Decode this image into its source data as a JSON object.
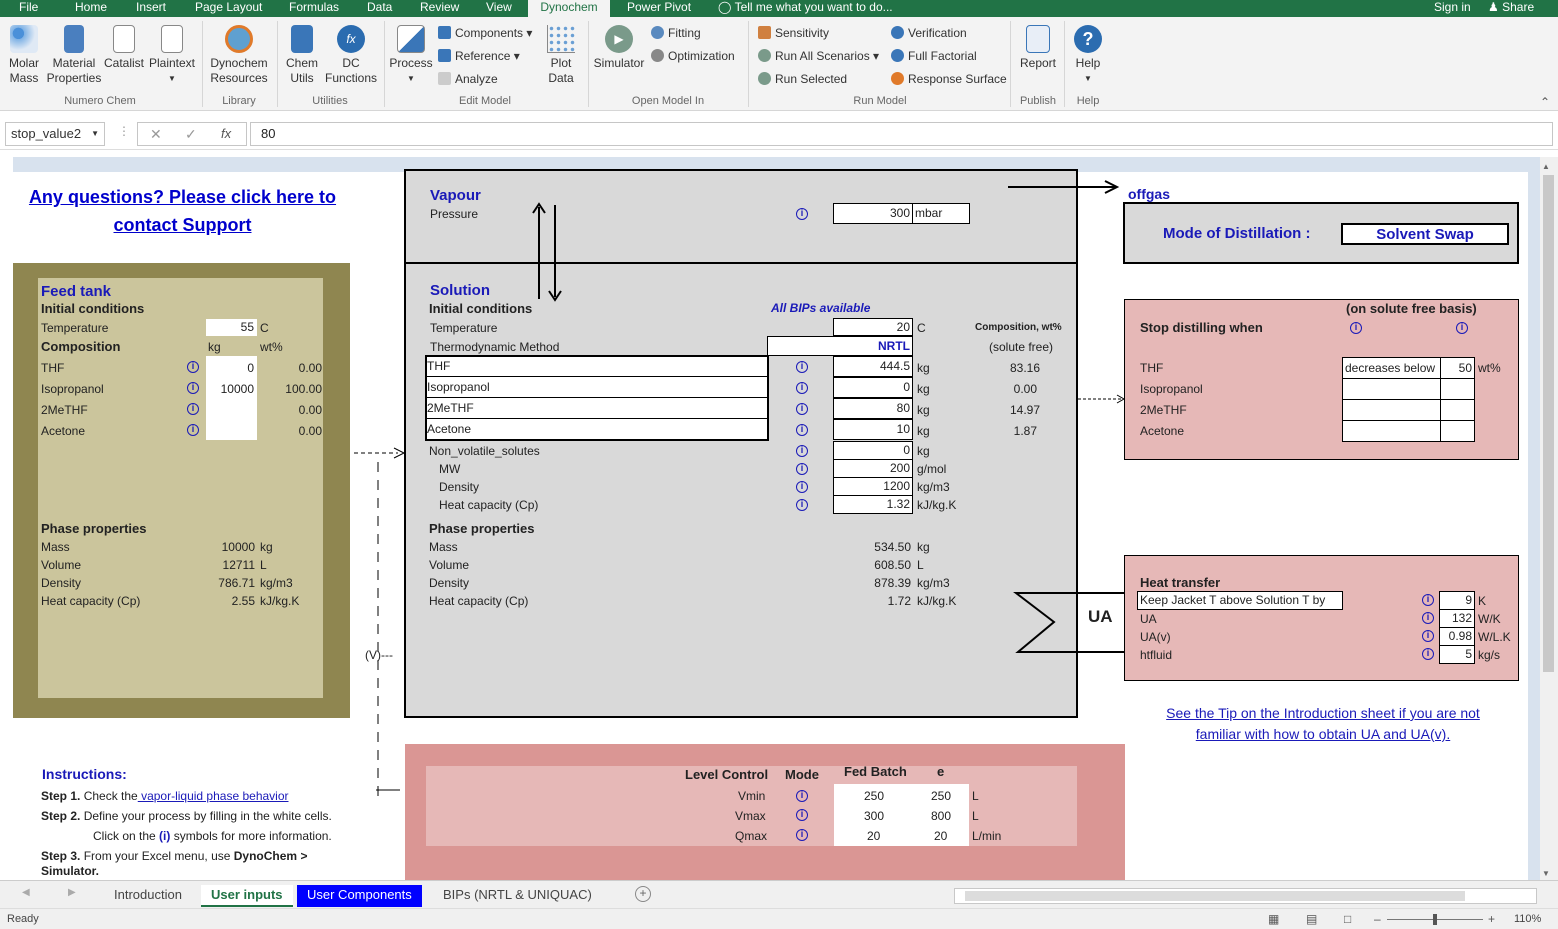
{
  "ribbon_tabs": [
    "File",
    "Home",
    "Insert",
    "Page Layout",
    "Formulas",
    "Data",
    "Review",
    "View",
    "Dynochem",
    "Power Pivot"
  ],
  "tell_me": "Tell me what you want to do...",
  "sign_in": "Sign in",
  "share": "Share",
  "ribbon": {
    "molar_mass": "Molar Mass",
    "material_properties": "Material Properties",
    "catalist": "Catalist",
    "plaintext": "Plaintext",
    "group_numero": "Numero Chem",
    "dynochem_resources": "Dynochem Resources",
    "group_library": "Library",
    "chem_utils": "Chem Utils",
    "dc_functions": "DC Functions",
    "group_utilities": "Utilities",
    "process": "Process",
    "components": "Components",
    "reference": "Reference",
    "analyze": "Analyze",
    "plot_data": "Plot Data",
    "group_edit": "Edit Model",
    "simulator": "Simulator",
    "fitting": "Fitting",
    "optimization": "Optimization",
    "group_open": "Open Model In",
    "sensitivity": "Sensitivity",
    "run_all": "Run All Scenarios",
    "run_selected": "Run Selected",
    "verification": "Verification",
    "full_factorial": "Full Factorial",
    "response_surface": "Response Surface",
    "group_run": "Run Model",
    "report": "Report",
    "group_publish": "Publish",
    "help": "Help",
    "group_help": "Help"
  },
  "formula": {
    "name_box": "stop_value2",
    "value": "80"
  },
  "support_link": "Any questions?  Please click here to contact Support",
  "feed": {
    "title": "Feed tank",
    "initial": "Initial conditions",
    "temp_label": "Temperature",
    "temp": "55",
    "temp_unit": "C",
    "composition": "Composition",
    "kg": "kg",
    "wtpct": "wt%",
    "rows": [
      {
        "name": "THF",
        "kg": "0",
        "wt": "0.00"
      },
      {
        "name": "Isopropanol",
        "kg": "10000",
        "wt": "100.00"
      },
      {
        "name": "2MeTHF",
        "kg": "",
        "wt": "0.00"
      },
      {
        "name": "Acetone",
        "kg": "",
        "wt": "0.00"
      }
    ],
    "phase": "Phase properties",
    "props": [
      {
        "n": "Mass",
        "v": "10000",
        "u": "kg"
      },
      {
        "n": "Volume",
        "v": "12711",
        "u": "L"
      },
      {
        "n": "Density",
        "v": "786.71",
        "u": "kg/m3"
      },
      {
        "n": "Heat capacity (Cp)",
        "v": "2.55",
        "u": "kJ/kg.K"
      }
    ]
  },
  "vapour": {
    "title": "Vapour",
    "pressure_label": "Pressure",
    "pressure": "300",
    "unit": "mbar"
  },
  "offgas": "offgas",
  "mode": {
    "label": "Mode of Distillation :",
    "value": "Solvent Swap"
  },
  "solution": {
    "title": "Solution",
    "initial": "Initial conditions",
    "bips": "All BIPs available",
    "temp_label": "Temperature",
    "temp": "20",
    "temp_unit": "C",
    "thermo_label": "Thermodynamic Method",
    "thermo": "NRTL",
    "comp_header": "Composition, wt%",
    "solute_free": "(solute free)",
    "rows": [
      {
        "name": "THF",
        "kg": "444.5",
        "wt": "83.16"
      },
      {
        "name": "Isopropanol",
        "kg": "0",
        "wt": "0.00"
      },
      {
        "name": "2MeTHF",
        "kg": "80",
        "wt": "14.97"
      },
      {
        "name": "Acetone",
        "kg": "10",
        "wt": "1.87"
      }
    ],
    "kg_unit": "kg",
    "nvs": [
      {
        "n": "Non_volatile_solutes",
        "v": "0",
        "u": "kg"
      },
      {
        "n": "MW",
        "v": "200",
        "u": "g/mol"
      },
      {
        "n": "Density",
        "v": "1200",
        "u": "kg/m3"
      },
      {
        "n": "Heat capacity (Cp)",
        "v": "1.32",
        "u": "kJ/kg.K"
      }
    ],
    "phase": "Phase properties",
    "props": [
      {
        "n": "Mass",
        "v": "534.50",
        "u": "kg"
      },
      {
        "n": "Volume",
        "v": "608.50",
        "u": "L"
      },
      {
        "n": "Density",
        "v": "878.39",
        "u": "kg/m3"
      },
      {
        "n": "Heat capacity (Cp)",
        "v": "1.72",
        "u": "kJ/kg.K"
      }
    ]
  },
  "stop": {
    "basis": "(on solute free basis)",
    "label": "Stop distilling when",
    "rows": [
      {
        "name": "THF",
        "cond": "decreases below",
        "val": "50",
        "unit": "wt%"
      },
      {
        "name": "Isopropanol",
        "cond": "",
        "val": "",
        "unit": ""
      },
      {
        "name": "2MeTHF",
        "cond": "",
        "val": "",
        "unit": ""
      },
      {
        "name": "Acetone",
        "cond": "",
        "val": "",
        "unit": ""
      }
    ]
  },
  "heat": {
    "title": "Heat transfer",
    "ua_badge": "UA",
    "rows": [
      {
        "n": "Keep Jacket T above Solution T by",
        "v": "9",
        "u": "K"
      },
      {
        "n": "UA",
        "v": "132",
        "u": "W/K"
      },
      {
        "n": "UA(v)",
        "v": "0.98",
        "u": "W/L.K"
      },
      {
        "n": "htfluid",
        "v": "5",
        "u": "kg/s"
      }
    ]
  },
  "tip": "See the Tip on the Introduction sheet if you are not familiar with how to obtain UA and UA(v).",
  "v_label": "(V)---",
  "level": {
    "h_level": "Level Control",
    "h_mode": "Mode",
    "h_fed": "Fed Batch",
    "h_e": "e",
    "rows": [
      {
        "n": "Vmin",
        "a": "250",
        "b": "250",
        "u": "L"
      },
      {
        "n": "Vmax",
        "a": "300",
        "b": "800",
        "u": "L"
      },
      {
        "n": "Qmax",
        "a": "20",
        "b": "20",
        "u": "L/min"
      }
    ]
  },
  "instructions": {
    "title": "Instructions:",
    "s1a": "Step 1.",
    "s1b": "Check the",
    "s1c": " vapor-liquid phase behavior",
    "s2a": "Step 2.",
    "s2b": "Define your process by filling in the white cells.",
    "s2c": "Click on the",
    "s2d": "(i)",
    "s2e": "symbols for more information.",
    "s3a": "Step 3.",
    "s3b": "From your Excel menu, use",
    "s3c": "DynoChem >",
    "s3d": "Simulator."
  },
  "sheet_tabs": [
    "Introduction",
    "User inputs",
    "User Components",
    "BIPs (NRTL & UNIQUAC)"
  ],
  "status": {
    "ready": "Ready",
    "zoom": "110%"
  }
}
